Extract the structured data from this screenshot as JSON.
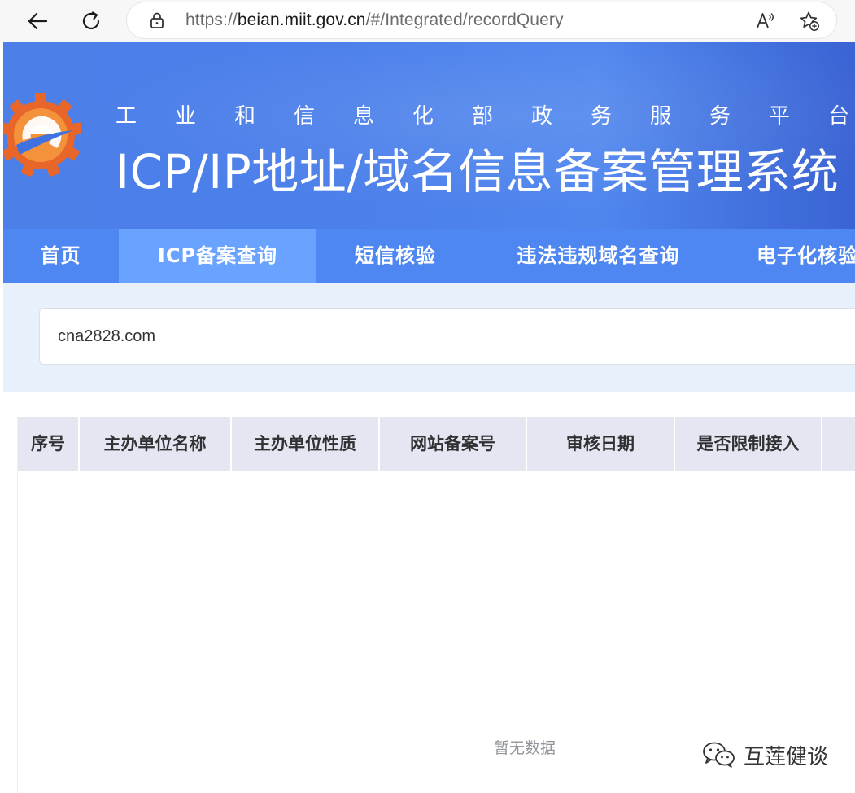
{
  "browser": {
    "back_icon": "arrow-left-icon",
    "refresh_icon": "refresh-icon",
    "url_scheme": "https://",
    "url_host": "beian.miit.gov.cn",
    "url_path": "/#/Integrated/recordQuery",
    "read_aloud_icon": "read-aloud-icon",
    "favorite_icon": "favorite-add-icon"
  },
  "header": {
    "subtitle": "工业和信息化部政务服务平台",
    "title": "ICP/IP地址/域名信息备案管理系统"
  },
  "menu": {
    "items": [
      {
        "label": "首页"
      },
      {
        "label": "ICP备案查询",
        "active": true
      },
      {
        "label": "短信核验"
      },
      {
        "label": "违法违规域名查询"
      },
      {
        "label": "电子化核验"
      }
    ]
  },
  "search": {
    "value": "cna2828.com"
  },
  "table": {
    "columns": [
      "序号",
      "主办单位名称",
      "主办单位性质",
      "网站备案号",
      "审核日期",
      "是否限制接入"
    ],
    "empty_text": "暂无数据"
  },
  "watermark": {
    "text": "互莲健谈",
    "icon": "wechat-icon"
  },
  "colors": {
    "header_blue": "#4c7fe8",
    "menu_blue": "#4f87f2",
    "menu_active": "#6aa3ff",
    "search_bg": "#e8f0fc",
    "table_header_bg": "#e4e7f2"
  }
}
